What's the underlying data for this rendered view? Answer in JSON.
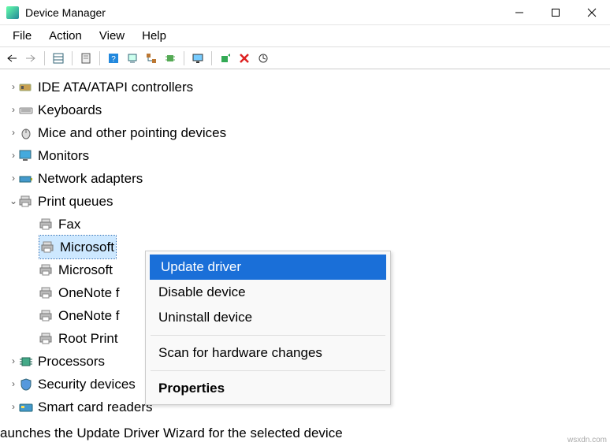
{
  "titlebar": {
    "title": "Device Manager"
  },
  "menubar": {
    "items": [
      "File",
      "Action",
      "View",
      "Help"
    ]
  },
  "tree": {
    "nodes": [
      {
        "level": 0,
        "caret": "closed",
        "icon": "ide",
        "label": "IDE ATA/ATAPI controllers"
      },
      {
        "level": 0,
        "caret": "closed",
        "icon": "keyboard",
        "label": "Keyboards"
      },
      {
        "level": 0,
        "caret": "closed",
        "icon": "mouse",
        "label": "Mice and other pointing devices"
      },
      {
        "level": 0,
        "caret": "closed",
        "icon": "monitor",
        "label": "Monitors"
      },
      {
        "level": 0,
        "caret": "closed",
        "icon": "netadapter",
        "label": "Network adapters"
      },
      {
        "level": 0,
        "caret": "open",
        "icon": "printer",
        "label": "Print queues"
      },
      {
        "level": 1,
        "caret": "none",
        "icon": "printer",
        "label": "Fax"
      },
      {
        "level": 1,
        "caret": "none",
        "icon": "printer",
        "label": "Microsoft",
        "selected": true
      },
      {
        "level": 1,
        "caret": "none",
        "icon": "printer",
        "label": "Microsoft"
      },
      {
        "level": 1,
        "caret": "none",
        "icon": "printer",
        "label": "OneNote f"
      },
      {
        "level": 1,
        "caret": "none",
        "icon": "printer",
        "label": "OneNote f"
      },
      {
        "level": 1,
        "caret": "none",
        "icon": "printer",
        "label": "Root Print"
      },
      {
        "level": 0,
        "caret": "closed",
        "icon": "processor",
        "label": "Processors"
      },
      {
        "level": 0,
        "caret": "closed",
        "icon": "security",
        "label": "Security devices"
      },
      {
        "level": 0,
        "caret": "closed",
        "icon": "smartcard",
        "label": "Smart card readers"
      }
    ]
  },
  "context_menu": {
    "items": [
      {
        "label": "Update driver",
        "highlight": true
      },
      {
        "label": "Disable device"
      },
      {
        "label": "Uninstall device"
      },
      {
        "sep": true
      },
      {
        "label": "Scan for hardware changes"
      },
      {
        "sep": true
      },
      {
        "label": "Properties",
        "bold": true
      }
    ]
  },
  "status": {
    "text": "aunches the Update Driver Wizard for the selected device"
  },
  "watermark": "wsxdn.com"
}
